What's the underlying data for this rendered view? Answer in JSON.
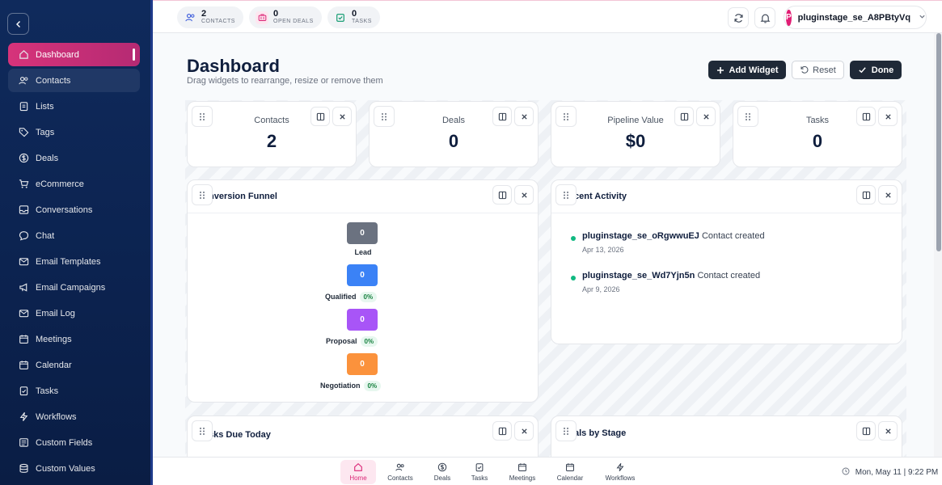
{
  "sidebar": {
    "items": [
      {
        "label": "Dashboard",
        "icon": "home-icon"
      },
      {
        "label": "Contacts",
        "icon": "users-icon"
      },
      {
        "label": "Lists",
        "icon": "clipboard-icon"
      },
      {
        "label": "Tags",
        "icon": "tag-icon"
      },
      {
        "label": "Deals",
        "icon": "dollar-icon"
      },
      {
        "label": "eCommerce",
        "icon": "cart-icon"
      },
      {
        "label": "Conversations",
        "icon": "inbox-icon"
      },
      {
        "label": "Chat",
        "icon": "chat-icon"
      },
      {
        "label": "Email Templates",
        "icon": "mail-icon"
      },
      {
        "label": "Email Campaigns",
        "icon": "megaphone-icon"
      },
      {
        "label": "Email Log",
        "icon": "mail-log-icon"
      },
      {
        "label": "Meetings",
        "icon": "calendar-icon"
      },
      {
        "label": "Calendar",
        "icon": "calendar-icon"
      },
      {
        "label": "Tasks",
        "icon": "clipboard-check-icon"
      },
      {
        "label": "Workflows",
        "icon": "bolt-icon"
      },
      {
        "label": "Custom Fields",
        "icon": "list-icon"
      },
      {
        "label": "Custom Values",
        "icon": "database-icon"
      }
    ]
  },
  "topbar": {
    "contacts": {
      "count": "2",
      "label": "CONTACTS"
    },
    "deals": {
      "count": "0",
      "label": "OPEN DEALS"
    },
    "tasks": {
      "count": "0",
      "label": "TASKS"
    },
    "user": {
      "initial": "P",
      "name": "pluginstage_se_A8PBtyVq"
    }
  },
  "page": {
    "title": "Dashboard",
    "subtitle": "Drag widgets to rearrange, resize or remove them",
    "add_widget": "Add Widget",
    "reset": "Reset",
    "done": "Done"
  },
  "stats": [
    {
      "label": "Contacts",
      "value": "2"
    },
    {
      "label": "Deals",
      "value": "0"
    },
    {
      "label": "Pipeline Value",
      "value": "$0"
    },
    {
      "label": "Tasks",
      "value": "0"
    }
  ],
  "funnel": {
    "title": "nversion Funnel",
    "steps": [
      {
        "label": "Lead",
        "value": "0",
        "pct": "",
        "color": "#6b7280"
      },
      {
        "label": "Qualified",
        "value": "0",
        "pct": "0%",
        "color": "#3b82f6"
      },
      {
        "label": "Proposal",
        "value": "0",
        "pct": "0%",
        "color": "#a855f7"
      },
      {
        "label": "Negotiation",
        "value": "0",
        "pct": "0%",
        "color": "#fb923c"
      }
    ]
  },
  "activity": {
    "title": "cent Activity",
    "items": [
      {
        "name": "pluginstage_se_oRgwwuEJ",
        "action": "Contact created",
        "date": "Apr 13, 2026"
      },
      {
        "name": "pluginstage_se_Wd7Yjn5n",
        "action": "Contact created",
        "date": "Apr 9, 2026"
      }
    ]
  },
  "tasks_widget": {
    "title": "sks Due Today"
  },
  "deals_stage": {
    "title": "als by Stage"
  },
  "bottom": {
    "tabs": [
      "Home",
      "Contacts",
      "Deals",
      "Tasks",
      "Meetings",
      "Calendar",
      "Workflows"
    ],
    "clock": "Mon, May 11 | 9:22 PM"
  },
  "colors": {
    "accent": "#db2777",
    "navy": "#0f2a5c",
    "dark_button": "#1f2937"
  }
}
